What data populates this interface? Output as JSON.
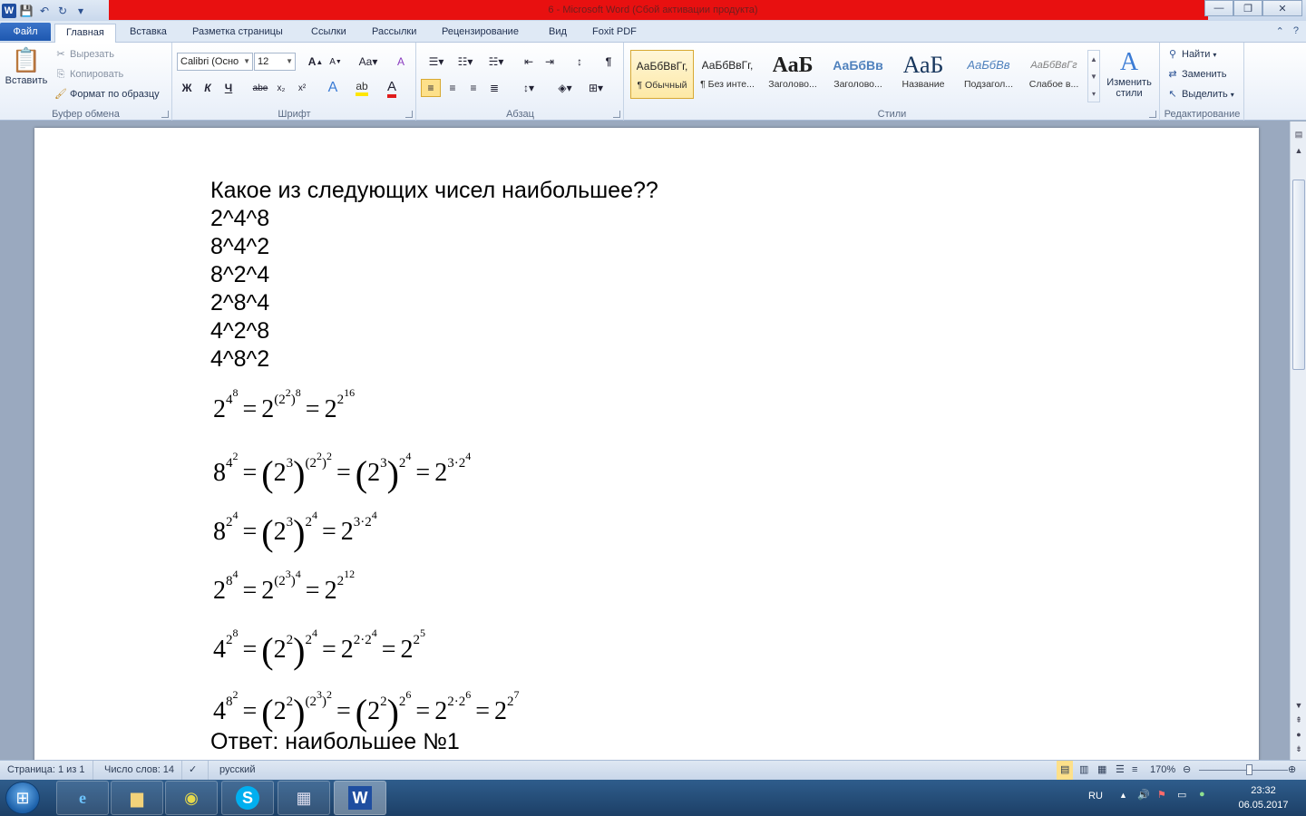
{
  "window": {
    "title": "6 - Microsoft Word (Сбой активации продукта)",
    "controls": {
      "minimize": "—",
      "maximize": "❐",
      "close": "✕"
    }
  },
  "qat": {
    "app_icon": "W",
    "save_icon": "💾",
    "undo_icon": "↶",
    "redo_icon": "↻",
    "customize_icon": "▾"
  },
  "tabs": [
    "Файл",
    "Главная",
    "Вставка",
    "Разметка страницы",
    "Ссылки",
    "Рассылки",
    "Рецензирование",
    "Вид",
    "Foxit PDF"
  ],
  "active_tab": "Главная",
  "ribbon": {
    "clipboard": {
      "label": "Буфер обмена",
      "paste": "Вставить",
      "cut": "Вырезать",
      "copy": "Копировать",
      "format_painter": "Формат по образцу"
    },
    "font": {
      "label": "Шрифт",
      "font_name": "Calibri (Осно",
      "font_size": "12",
      "bold": "Ж",
      "italic": "К",
      "underline": "Ч",
      "strike": "abe",
      "subscript": "x₂",
      "superscript": "x²",
      "grow": "A",
      "shrink": "A",
      "case": "Aa",
      "clear": "A"
    },
    "paragraph": {
      "label": "Абзац",
      "pilcrow": "¶"
    },
    "styles": {
      "label": "Стили",
      "items": [
        {
          "sample": "АаБбВвГг,",
          "name": "¶ Обычный"
        },
        {
          "sample": "АаБбВвГг,",
          "name": "¶ Без инте..."
        },
        {
          "sample": "АаБ",
          "name": "Заголово..."
        },
        {
          "sample": "АаБбВв",
          "name": "Заголово..."
        },
        {
          "sample": "АаБ",
          "name": "Название"
        },
        {
          "sample": "АаБбВв",
          "name": "Подзагол..."
        },
        {
          "sample": "АаБбВвГг",
          "name": "Слабое в..."
        }
      ],
      "change_styles": "Изменить стили"
    },
    "editing": {
      "label": "Редактирование",
      "find": "Найти",
      "replace": "Заменить",
      "select": "Выделить"
    }
  },
  "document": {
    "question": "Какое из следующих чисел наибольшее??",
    "options": [
      "2^4^8",
      "8^4^2",
      "8^2^4",
      "2^8^4",
      "4^2^8",
      "4^8^2"
    ],
    "answer": "Ответ: наибольшее №1"
  },
  "statusbar": {
    "page": "Страница: 1 из 1",
    "words": "Число слов: 14",
    "language": "русский",
    "zoom": "170%"
  },
  "taskbar": {
    "lang": "RU",
    "time": "23:32",
    "date": "06.05.2017"
  }
}
